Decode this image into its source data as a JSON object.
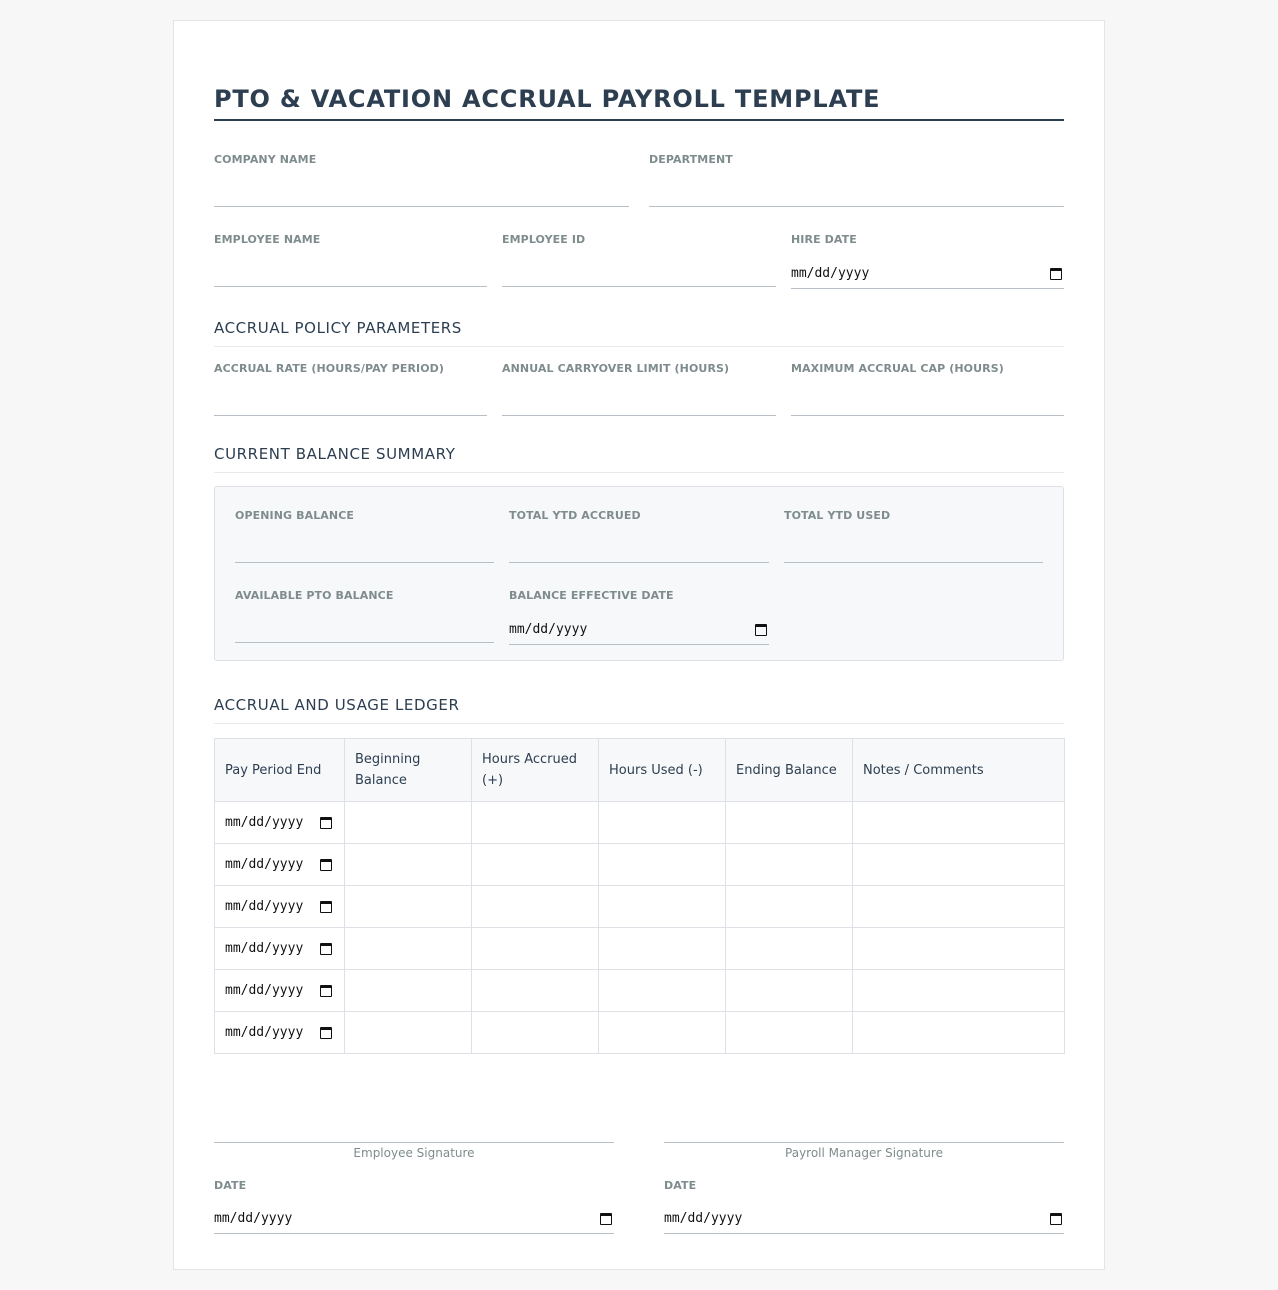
{
  "document": {
    "title": "PTO & VACATION ACCRUAL PAYROLL TEMPLATE"
  },
  "header_fields": {
    "company_name_label": "COMPANY NAME",
    "department_label": "DEPARTMENT",
    "employee_name_label": "EMPLOYEE NAME",
    "employee_id_label": "EMPLOYEE ID",
    "hire_date_label": "HIRE DATE",
    "hire_date_value": "mm/dd/yyyy"
  },
  "policy": {
    "section_title": "ACCRUAL POLICY PARAMETERS",
    "accrual_rate_label": "ACCRUAL RATE (HOURS/PAY PERIOD)",
    "carryover_label": "ANNUAL CARRYOVER LIMIT (HOURS)",
    "max_cap_label": "MAXIMUM ACCRUAL CAP (HOURS)"
  },
  "summary": {
    "section_title": "CURRENT BALANCE SUMMARY",
    "opening_balance_label": "OPENING BALANCE",
    "ytd_accrued_label": "TOTAL YTD ACCRUED",
    "ytd_used_label": "TOTAL YTD USED",
    "available_label": "AVAILABLE PTO BALANCE",
    "effective_date_label": "BALANCE EFFECTIVE DATE",
    "effective_date_value": "mm/dd/yyyy"
  },
  "ledger": {
    "section_title": "ACCRUAL AND USAGE LEDGER",
    "columns": [
      "Pay Period End",
      "Beginning Balance",
      "Hours Accrued (+)",
      "Hours Used (-)",
      "Ending Balance",
      "Notes / Comments"
    ],
    "rows": [
      {
        "date": "mm/dd/yyyy"
      },
      {
        "date": "mm/dd/yyyy"
      },
      {
        "date": "mm/dd/yyyy"
      },
      {
        "date": "mm/dd/yyyy"
      },
      {
        "date": "mm/dd/yyyy"
      },
      {
        "date": "mm/dd/yyyy"
      }
    ]
  },
  "signatures": {
    "employee_caption": "Employee Signature",
    "manager_caption": "Payroll Manager Signature",
    "employee_date_label": "DATE",
    "employee_date_value": "mm/dd/yyyy",
    "manager_date_label": "DATE",
    "manager_date_value": "mm/dd/yyyy"
  },
  "icons": {
    "date_picker": "calendar-icon"
  }
}
